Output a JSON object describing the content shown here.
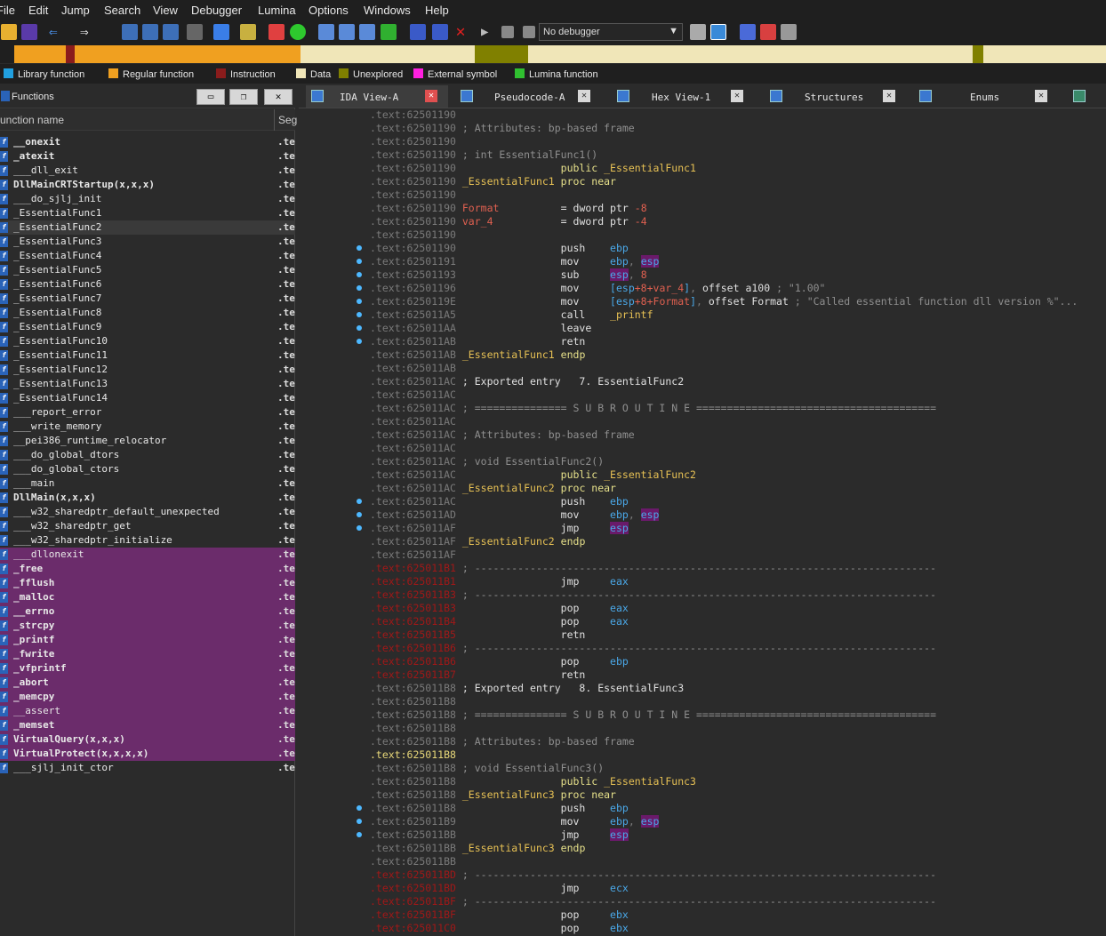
{
  "menu": [
    "File",
    "Edit",
    "Jump",
    "Search",
    "View",
    "Debugger",
    "Lumina",
    "Options",
    "Windows",
    "Help"
  ],
  "toolbar": {
    "debugger_select": "No debugger"
  },
  "legend": [
    {
      "label": "Library function",
      "color": "#21a0e0"
    },
    {
      "label": "Regular function",
      "color": "#f0a020"
    },
    {
      "label": "Instruction",
      "color": "#8a1c1c"
    },
    {
      "label": "Data",
      "color": "#f0e6b8"
    },
    {
      "label": "Unexplored",
      "color": "#808000"
    },
    {
      "label": "External symbol",
      "color": "#ff20e0"
    },
    {
      "label": "Lumina function",
      "color": "#30c030"
    }
  ],
  "functions_panel": {
    "title": "Functions",
    "col_name": "unction name",
    "col_seg": "Seg",
    "items": [
      {
        "name": "__onexit",
        "seg": ".te",
        "style": "b"
      },
      {
        "name": "_atexit",
        "seg": ".te",
        "style": "b"
      },
      {
        "name": "___dll_exit",
        "seg": ".te",
        "style": ""
      },
      {
        "name": "DllMainCRTStartup(x,x,x)",
        "seg": ".te",
        "style": "b"
      },
      {
        "name": "___do_sjlj_init",
        "seg": ".te",
        "style": ""
      },
      {
        "name": "_EssentialFunc1",
        "seg": ".te",
        "style": ""
      },
      {
        "name": "_EssentialFunc2",
        "seg": ".te",
        "style": "sel"
      },
      {
        "name": "_EssentialFunc3",
        "seg": ".te",
        "style": ""
      },
      {
        "name": "_EssentialFunc4",
        "seg": ".te",
        "style": ""
      },
      {
        "name": "_EssentialFunc5",
        "seg": ".te",
        "style": ""
      },
      {
        "name": "_EssentialFunc6",
        "seg": ".te",
        "style": ""
      },
      {
        "name": "_EssentialFunc7",
        "seg": ".te",
        "style": ""
      },
      {
        "name": "_EssentialFunc8",
        "seg": ".te",
        "style": ""
      },
      {
        "name": "_EssentialFunc9",
        "seg": ".te",
        "style": ""
      },
      {
        "name": "_EssentialFunc10",
        "seg": ".te",
        "style": ""
      },
      {
        "name": "_EssentialFunc11",
        "seg": ".te",
        "style": ""
      },
      {
        "name": "_EssentialFunc12",
        "seg": ".te",
        "style": ""
      },
      {
        "name": "_EssentialFunc13",
        "seg": ".te",
        "style": ""
      },
      {
        "name": "_EssentialFunc14",
        "seg": ".te",
        "style": ""
      },
      {
        "name": "___report_error",
        "seg": ".te",
        "style": ""
      },
      {
        "name": "___write_memory",
        "seg": ".te",
        "style": ""
      },
      {
        "name": "__pei386_runtime_relocator",
        "seg": ".te",
        "style": ""
      },
      {
        "name": "___do_global_dtors",
        "seg": ".te",
        "style": ""
      },
      {
        "name": "___do_global_ctors",
        "seg": ".te",
        "style": ""
      },
      {
        "name": "___main",
        "seg": ".te",
        "style": ""
      },
      {
        "name": "DllMain(x,x,x)",
        "seg": ".te",
        "style": "b"
      },
      {
        "name": "___w32_sharedptr_default_unexpected",
        "seg": ".te",
        "style": ""
      },
      {
        "name": "___w32_sharedptr_get",
        "seg": ".te",
        "style": ""
      },
      {
        "name": "___w32_sharedptr_initialize",
        "seg": ".te",
        "style": ""
      },
      {
        "name": "___dllonexit",
        "seg": ".te",
        "style": "lib"
      },
      {
        "name": "_free",
        "seg": ".te",
        "style": "lib b"
      },
      {
        "name": "_fflush",
        "seg": ".te",
        "style": "lib b"
      },
      {
        "name": "_malloc",
        "seg": ".te",
        "style": "lib b"
      },
      {
        "name": "__errno",
        "seg": ".te",
        "style": "lib b"
      },
      {
        "name": "_strcpy",
        "seg": ".te",
        "style": "lib b"
      },
      {
        "name": "_printf",
        "seg": ".te",
        "style": "lib b"
      },
      {
        "name": "_fwrite",
        "seg": ".te",
        "style": "lib b"
      },
      {
        "name": "_vfprintf",
        "seg": ".te",
        "style": "lib b"
      },
      {
        "name": "_abort",
        "seg": ".te",
        "style": "lib b"
      },
      {
        "name": "_memcpy",
        "seg": ".te",
        "style": "lib b"
      },
      {
        "name": "__assert",
        "seg": ".te",
        "style": "lib"
      },
      {
        "name": "_memset",
        "seg": ".te",
        "style": "lib b"
      },
      {
        "name": "VirtualQuery(x,x,x)",
        "seg": ".te",
        "style": "lib b"
      },
      {
        "name": "VirtualProtect(x,x,x,x)",
        "seg": ".te",
        "style": "lib b"
      },
      {
        "name": "___sjlj_init_ctor",
        "seg": ".te",
        "style": ""
      }
    ]
  },
  "tabs": [
    {
      "label": "IDA View-A",
      "active": true
    },
    {
      "label": "Pseudocode-A",
      "active": false
    },
    {
      "label": "Hex View-1",
      "active": false
    },
    {
      "label": "Structures",
      "active": false
    },
    {
      "label": "Enums",
      "active": false
    }
  ],
  "disasm": [
    {
      "a": ".text:62501190",
      "c": "",
      "k": "n"
    },
    {
      "a": ".text:62501190",
      "c": "; Attributes: bp-based frame",
      "k": "cm"
    },
    {
      "a": ".text:62501190",
      "c": "",
      "k": "n"
    },
    {
      "a": ".text:62501190",
      "c": "; int EssentialFunc1()",
      "k": "cm"
    },
    {
      "a": ".text:62501190",
      "c": "                public _EssentialFunc1",
      "k": "pub"
    },
    {
      "a": ".text:62501190",
      "c": "_EssentialFunc1 proc near",
      "k": "proc"
    },
    {
      "a": ".text:62501190",
      "c": "",
      "k": "n"
    },
    {
      "a": ".text:62501190",
      "c": "Format          = dword ptr -8",
      "k": "var"
    },
    {
      "a": ".text:62501190",
      "c": "var_4           = dword ptr -4",
      "k": "var"
    },
    {
      "a": ".text:62501190",
      "c": "",
      "k": "n"
    },
    {
      "a": ".text:62501190",
      "c": "                push    ebp",
      "k": "ins",
      "d": 1
    },
    {
      "a": ".text:62501191",
      "c": "                mov     ebp, esp",
      "k": "ins",
      "d": 1
    },
    {
      "a": ".text:62501193",
      "c": "                sub     esp, 8",
      "k": "ins",
      "d": 1
    },
    {
      "a": ".text:62501196",
      "c": "                mov     [esp+8+var_4], offset a100 ; \"1.00\"",
      "k": "ins",
      "d": 1
    },
    {
      "a": ".text:6250119E",
      "c": "                mov     [esp+8+Format], offset Format ; \"Called essential function dll version %\"...",
      "k": "ins",
      "d": 1
    },
    {
      "a": ".text:625011A5",
      "c": "                call    _printf",
      "k": "ins",
      "d": 1
    },
    {
      "a": ".text:625011AA",
      "c": "                leave",
      "k": "ins",
      "d": 1
    },
    {
      "a": ".text:625011AB",
      "c": "                retn",
      "k": "ins",
      "d": 1
    },
    {
      "a": ".text:625011AB",
      "c": "_EssentialFunc1 endp",
      "k": "proc"
    },
    {
      "a": ".text:625011AB",
      "c": "",
      "k": "n"
    },
    {
      "a": ".text:625011AC",
      "c": "; Exported entry   7. EssentialFunc2",
      "k": "exp"
    },
    {
      "a": ".text:625011AC",
      "c": "",
      "k": "n"
    },
    {
      "a": ".text:625011AC",
      "c": "; =============== S U B R O U T I N E =======================================",
      "k": "cm"
    },
    {
      "a": ".text:625011AC",
      "c": "",
      "k": "n"
    },
    {
      "a": ".text:625011AC",
      "c": "; Attributes: bp-based frame",
      "k": "cm"
    },
    {
      "a": ".text:625011AC",
      "c": "",
      "k": "n"
    },
    {
      "a": ".text:625011AC",
      "c": "; void EssentialFunc2()",
      "k": "cm"
    },
    {
      "a": ".text:625011AC",
      "c": "                public _EssentialFunc2",
      "k": "pub"
    },
    {
      "a": ".text:625011AC",
      "c": "_EssentialFunc2 proc near",
      "k": "proc"
    },
    {
      "a": ".text:625011AC",
      "c": "                push    ebp",
      "k": "ins",
      "d": 1
    },
    {
      "a": ".text:625011AD",
      "c": "                mov     ebp, esp",
      "k": "ins",
      "d": 1
    },
    {
      "a": ".text:625011AF",
      "c": "                jmp     esp",
      "k": "ins",
      "d": 1
    },
    {
      "a": ".text:625011AF",
      "c": "_EssentialFunc2 endp",
      "k": "proc"
    },
    {
      "a": ".text:625011AF",
      "c": "",
      "k": "n"
    },
    {
      "a": ".text:625011B1",
      "c": "; ---------------------------------------------------------------------------",
      "k": "cm",
      "r": 1
    },
    {
      "a": ".text:625011B1",
      "c": "                jmp     eax",
      "k": "ins",
      "r": 1
    },
    {
      "a": ".text:625011B3",
      "c": "; ---------------------------------------------------------------------------",
      "k": "cm",
      "r": 1
    },
    {
      "a": ".text:625011B3",
      "c": "                pop     eax",
      "k": "ins",
      "r": 1
    },
    {
      "a": ".text:625011B4",
      "c": "                pop     eax",
      "k": "ins",
      "r": 1
    },
    {
      "a": ".text:625011B5",
      "c": "                retn",
      "k": "ins",
      "r": 1
    },
    {
      "a": ".text:625011B6",
      "c": "; ---------------------------------------------------------------------------",
      "k": "cm",
      "r": 1
    },
    {
      "a": ".text:625011B6",
      "c": "                pop     ebp",
      "k": "ins",
      "r": 1
    },
    {
      "a": ".text:625011B7",
      "c": "                retn",
      "k": "ins",
      "r": 1
    },
    {
      "a": ".text:625011B8",
      "c": "; Exported entry   8. EssentialFunc3",
      "k": "exp"
    },
    {
      "a": ".text:625011B8",
      "c": "",
      "k": "n"
    },
    {
      "a": ".text:625011B8",
      "c": "; =============== S U B R O U T I N E =======================================",
      "k": "cm"
    },
    {
      "a": ".text:625011B8",
      "c": "",
      "k": "n"
    },
    {
      "a": ".text:625011B8",
      "c": "; Attributes: bp-based frame",
      "k": "cm"
    },
    {
      "a": ".text:625011B8",
      "c": "",
      "k": "n",
      "y": 1
    },
    {
      "a": ".text:625011B8",
      "c": "; void EssentialFunc3()",
      "k": "cm"
    },
    {
      "a": ".text:625011B8",
      "c": "                public _EssentialFunc3",
      "k": "pub"
    },
    {
      "a": ".text:625011B8",
      "c": "_EssentialFunc3 proc near",
      "k": "proc"
    },
    {
      "a": ".text:625011B8",
      "c": "                push    ebp",
      "k": "ins",
      "d": 1
    },
    {
      "a": ".text:625011B9",
      "c": "                mov     ebp, esp",
      "k": "ins",
      "d": 1
    },
    {
      "a": ".text:625011BB",
      "c": "                jmp     esp",
      "k": "ins",
      "d": 1
    },
    {
      "a": ".text:625011BB",
      "c": "_EssentialFunc3 endp",
      "k": "proc"
    },
    {
      "a": ".text:625011BB",
      "c": "",
      "k": "n"
    },
    {
      "a": ".text:625011BD",
      "c": "; ---------------------------------------------------------------------------",
      "k": "cm",
      "r": 1
    },
    {
      "a": ".text:625011BD",
      "c": "                jmp     ecx",
      "k": "ins",
      "r": 1
    },
    {
      "a": ".text:625011BF",
      "c": "; ---------------------------------------------------------------------------",
      "k": "cm",
      "r": 1
    },
    {
      "a": ".text:625011BF",
      "c": "                pop     ebx",
      "k": "ins",
      "r": 1
    },
    {
      "a": ".text:625011C0",
      "c": "                pop     ebx",
      "k": "ins",
      "r": 1
    }
  ]
}
